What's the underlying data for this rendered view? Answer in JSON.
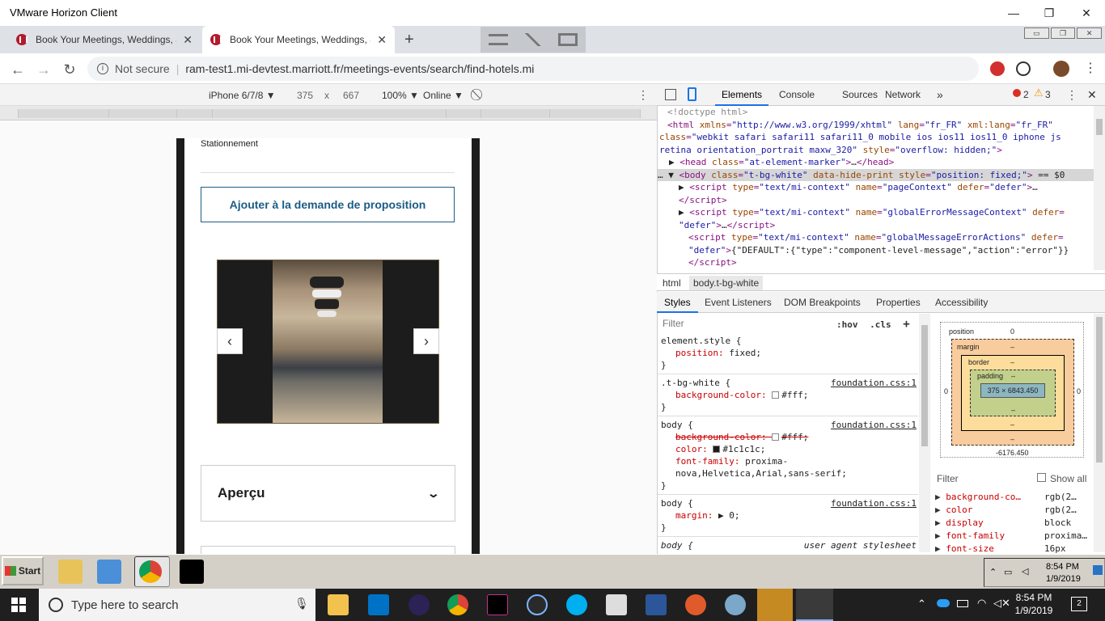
{
  "window": {
    "title": "VMware Horizon Client",
    "min": "—",
    "max": "❐",
    "close": "✕"
  },
  "tabs": [
    {
      "label": "Book Your Meetings, Weddings, and",
      "close": "✕"
    },
    {
      "label": "Book Your Meetings, Weddings, and",
      "close": "✕"
    }
  ],
  "newtab": "+",
  "vmwin": [
    "▭",
    "❐",
    "✕"
  ],
  "address": {
    "not_secure": "Not secure",
    "url": "ram-test1.mi-devtest.marriott.fr/meetings-events/search/find-hotels.mi"
  },
  "device_toolbar": {
    "device": "iPhone 6/7/8 ▼",
    "width": "375",
    "x": "x",
    "height": "667",
    "zoom": "100% ▼",
    "network": "Online ▼",
    "more": "⋮"
  },
  "page": {
    "stationnement": "Stationnement",
    "add_button": "Ajouter à la demande de proposition",
    "prev": "‹",
    "next": "›",
    "apercu": "Aperçu",
    "chevron": "⌄"
  },
  "devtools": {
    "tabs": [
      "Elements",
      "Console",
      "Sources",
      "Network"
    ],
    "more_tabs": "»",
    "errors": "2",
    "warnings": "3",
    "kebab": "⋮",
    "close": "✕",
    "breadcrumb": [
      "html",
      "body.t-bg-white"
    ],
    "styles_tabs": [
      "Styles",
      "Event Listeners",
      "DOM Breakpoints",
      "Properties",
      "Accessibility"
    ],
    "filter": "Filter",
    "hov": ":hov",
    "cls": ".cls",
    "plus": "+",
    "rules": [
      {
        "selector": "element.style {",
        "source": "",
        "props": [
          {
            "name": "position",
            "value": "fixed;"
          }
        ]
      },
      {
        "selector": ".t-bg-white {",
        "source": "foundation.css:1",
        "props": [
          {
            "name": "background-color",
            "value": "#fff;",
            "swatch": "#ffffff"
          }
        ]
      },
      {
        "selector": "body {",
        "source": "foundation.css:1",
        "props": [
          {
            "name": "background-color",
            "value": "#fff;",
            "swatch": "#ffffff",
            "strike": true
          },
          {
            "name": "color",
            "value": "#1c1c1c;",
            "swatch": "#1c1c1c"
          },
          {
            "name": "font-family",
            "value": "proxima-nova,Helvetica,Arial,sans-serif;"
          }
        ]
      },
      {
        "selector": "body {",
        "source": "foundation.css:1",
        "props": [
          {
            "name": "margin",
            "value": "▶ 0;"
          }
        ]
      },
      {
        "selector": "body {",
        "source": "user agent stylesheet",
        "props": [
          {
            "name": "display",
            "value": "block;"
          }
        ]
      }
    ],
    "boxmodel": {
      "position_label": "position",
      "position_value": "0",
      "margin_label": "margin",
      "border_label": "border",
      "padding_label": "padding",
      "content": "375 × 6843.450",
      "dash": "–",
      "left": "0",
      "right": "0",
      "bottom": "-6176.450"
    },
    "computed_filter": "Filter",
    "show_all": "Show all",
    "computed": [
      {
        "name": "background-co…",
        "value": "rgb(2…"
      },
      {
        "name": "color",
        "value": "rgb(2…"
      },
      {
        "name": "display",
        "value": "block"
      },
      {
        "name": "font-family",
        "value": "proxima…"
      },
      {
        "name": "font-size",
        "value": "16px"
      }
    ]
  },
  "vm_taskbar": {
    "start": "Start",
    "time": "8:54 PM",
    "date": "1/9/2019"
  },
  "win_taskbar": {
    "search": "Type here to search",
    "time": "8:54 PM",
    "date": "1/9/2019",
    "notif": "2"
  },
  "colors": {
    "accent": "#1a73e8",
    "marriott_blue": "#1c5c85",
    "error": "#d93025",
    "warning": "#f29900"
  }
}
